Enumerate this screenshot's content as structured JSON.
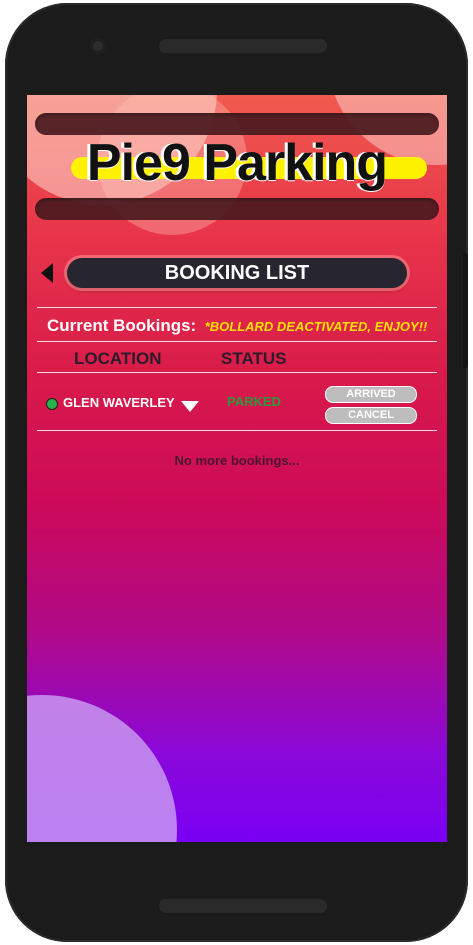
{
  "app": {
    "title": "Pie9 Parking"
  },
  "header": {
    "title": "BOOKING LIST"
  },
  "current_bookings": {
    "label": "Current Bookings:",
    "notice": "*BOLLARD DEACTIVATED, ENJOY!!"
  },
  "table": {
    "columns": [
      "LOCATION",
      "STATUS"
    ],
    "rows": [
      {
        "location": "GLEN WAVERLEY",
        "status": "PARKED",
        "actions": [
          "ARRIVED",
          "CANCEL"
        ]
      }
    ]
  },
  "empty_message": "No more bookings...",
  "colors": {
    "title_highlight": "#fff200",
    "notice": "#ffe000",
    "status_parked": "#2c9a3a",
    "status_dot": "#2bb24c",
    "header_pill": "#272630"
  },
  "icons": {
    "back": "back-arrow-icon",
    "location_status": "status-dot-icon",
    "dropdown": "caret-down-icon"
  }
}
